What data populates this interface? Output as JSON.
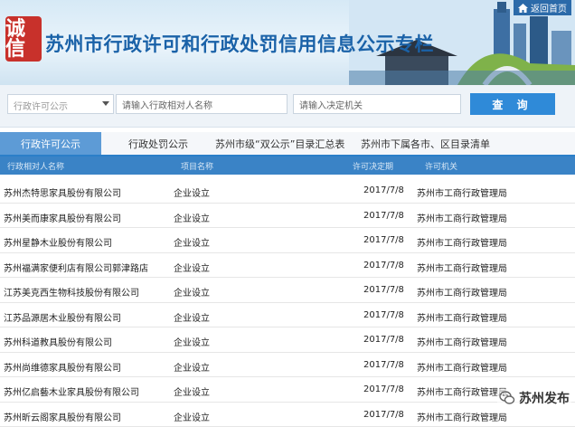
{
  "header": {
    "logo_text": "诚信",
    "title": "苏州市行政许可和行政处罚信用信息公示专栏",
    "home_link": "返回首页"
  },
  "search": {
    "type_select": "行政许可公示",
    "object_placeholder": "请输入行政相对人名称",
    "org_placeholder": "请输入决定机关",
    "query_button": "查 询"
  },
  "tabs": [
    {
      "label": "行政许可公示",
      "active": true
    },
    {
      "label": "行政处罚公示",
      "active": false
    },
    {
      "label": "苏州市级“双公示”目录汇总表",
      "active": false
    },
    {
      "label": "苏州市下属各市、区目录清单",
      "active": false
    }
  ],
  "table": {
    "columns": [
      "行政相对人名称",
      "项目名称",
      "许可决定期",
      "许可机关"
    ],
    "rows": [
      {
        "name": "苏州杰特思家具股份有限公司",
        "project": "企业设立",
        "date": "2017/7/8",
        "org": "苏州市工商行政管理局"
      },
      {
        "name": "苏州美而康家具股份有限公司",
        "project": "企业设立",
        "date": "2017/7/8",
        "org": "苏州市工商行政管理局"
      },
      {
        "name": "苏州星静木业股份有限公司",
        "project": "企业设立",
        "date": "2017/7/8",
        "org": "苏州市工商行政管理局"
      },
      {
        "name": "苏州福满家便利店有限公司郭津路店",
        "project": "企业设立",
        "date": "2017/7/8",
        "org": "苏州市工商行政管理局"
      },
      {
        "name": "江苏美克西生物科技股份有限公司",
        "project": "企业设立",
        "date": "2017/7/8",
        "org": "苏州市工商行政管理局"
      },
      {
        "name": "江苏品源居木业股份有限公司",
        "project": "企业设立",
        "date": "2017/7/8",
        "org": "苏州市工商行政管理局"
      },
      {
        "name": "苏州科道教具股份有限公司",
        "project": "企业设立",
        "date": "2017/7/8",
        "org": "苏州市工商行政管理局"
      },
      {
        "name": "苏州尚维德家具股份有限公司",
        "project": "企业设立",
        "date": "2017/7/8",
        "org": "苏州市工商行政管理局"
      },
      {
        "name": "苏州亿启藝木业家具股份有限公司",
        "project": "企业设立",
        "date": "2017/7/8",
        "org": "苏州市工商行政管理局"
      },
      {
        "name": "苏州昕云阁家具股份有限公司",
        "project": "企业设立",
        "date": "2017/7/8",
        "org": "苏州市工商行政管理局"
      }
    ]
  },
  "watermark": {
    "text": "苏州发布",
    "icon": "wechat-icon"
  },
  "colors": {
    "brand_blue": "#1a62a8",
    "tab_active": "#5d9bd6",
    "table_header": "#3a83c6",
    "query_button": "#2f8ad8",
    "logo_red": "#c8312b"
  }
}
